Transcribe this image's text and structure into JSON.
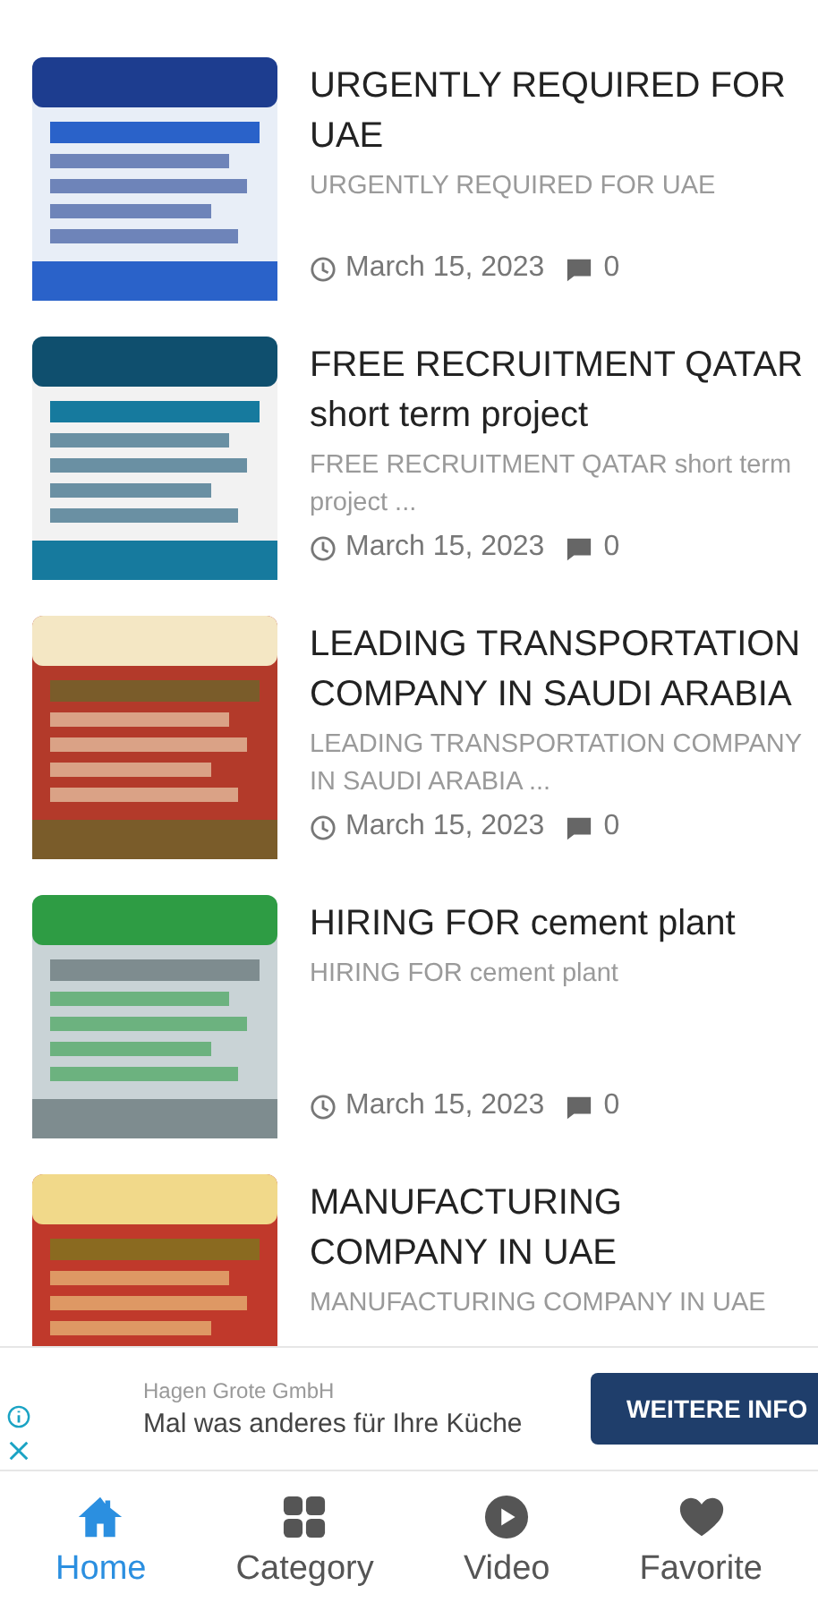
{
  "posts": [
    {
      "title": "URGENTLY REQUIRED FOR UAE",
      "excerpt": "URGENTLY REQUIRED FOR UAE",
      "date": "March 15, 2023",
      "comments": "0"
    },
    {
      "title": "FREE RECRUITMENT QATAR short term project",
      "excerpt": "FREE RECRUITMENT QATAR short term project ...",
      "date": "March 15, 2023",
      "comments": "0"
    },
    {
      "title": "LEADING TRANSPORTATION COMPANY IN SAUDI ARABIA",
      "excerpt": "LEADING TRANSPORTATION COMPANY IN SAUDI ARABIA ...",
      "date": "March 15, 2023",
      "comments": "0"
    },
    {
      "title": "HIRING FOR cement plant",
      "excerpt": "HIRING FOR cement plant",
      "date": "March 15, 2023",
      "comments": "0"
    },
    {
      "title": "MANUFACTURING COMPANY IN UAE",
      "excerpt": "MANUFACTURING COMPANY IN UAE"
    }
  ],
  "ad": {
    "advertiser": "Hagen Grote GmbH",
    "headline": "Mal was anderes für Ihre Küche",
    "button": "WEITERE INFO"
  },
  "nav": [
    {
      "kind": "home",
      "label": "Home",
      "selected": true
    },
    {
      "kind": "category",
      "label": "Category",
      "selected": false
    },
    {
      "kind": "video",
      "label": "Video",
      "selected": false
    },
    {
      "kind": "favorite",
      "label": "Favorite",
      "selected": false
    }
  ]
}
